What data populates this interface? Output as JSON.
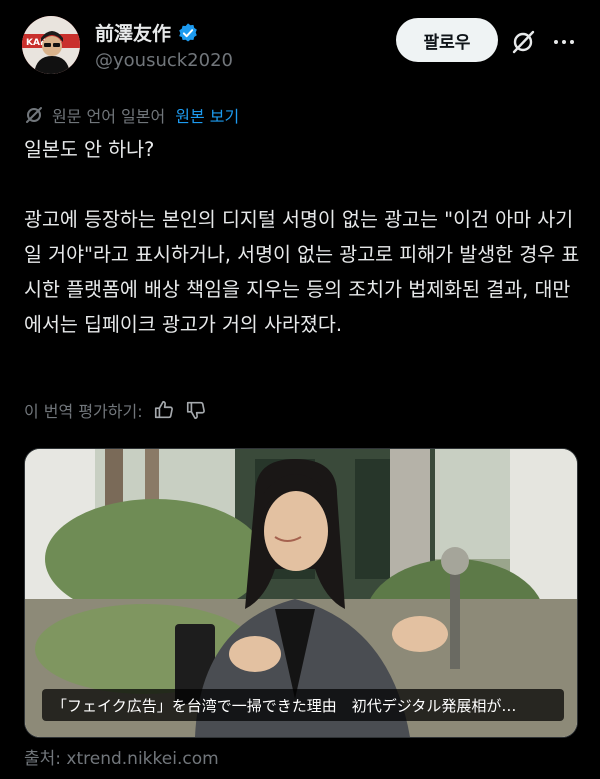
{
  "author": {
    "display_name": "前澤友作",
    "handle": "@yousuck2020",
    "avatar_text": "KABU&"
  },
  "header": {
    "follow_label": "팔로우"
  },
  "translation": {
    "note": "원문 언어 일본어",
    "show_original": "원본 보기"
  },
  "post": {
    "text": "일본도 안 하나?\n\n광고에 등장하는 본인의 디지털 서명이 없는 광고는 \"이건 아마 사기일 거야\"라고 표시하거나, 서명이 없는 광고로 피해가 발생한 경우 표시한 플랫폼에 배상 책임을 지우는 등의 조치가 법제화된 결과, 대만에서는 딥페이크 광고가 거의 사라졌다."
  },
  "rating": {
    "label": "이 번역 평가하기:"
  },
  "media": {
    "caption": "「フェイク広告」を台湾で一掃できた理由　初代デジタル発展相が…",
    "source": "출처: xtrend.nikkei.com"
  },
  "colors": {
    "background": "#000000",
    "text": "#e7e9ea",
    "muted": "#71767b",
    "link": "#1d9bf0",
    "verified": "#1d9bf0"
  }
}
